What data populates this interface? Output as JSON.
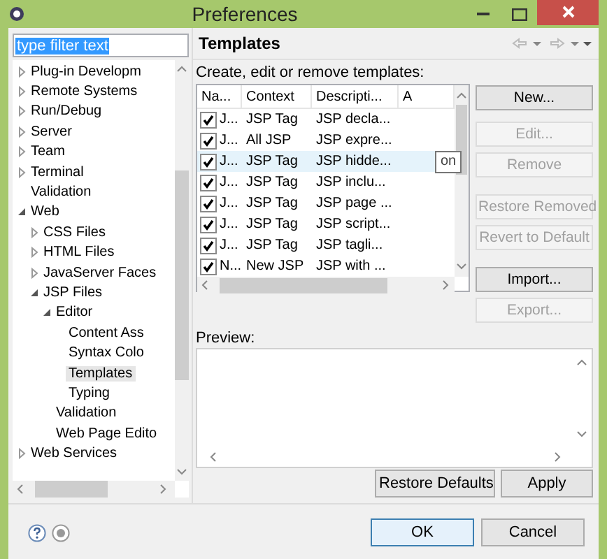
{
  "window": {
    "title": "Preferences"
  },
  "filter": {
    "value": "type filter text"
  },
  "tree": [
    {
      "label": "Plug-in Developm",
      "expanded": false,
      "selected": false
    },
    {
      "label": "Remote Systems",
      "expanded": false,
      "selected": false
    },
    {
      "label": "Run/Debug",
      "expanded": false,
      "selected": false
    },
    {
      "label": "Server",
      "expanded": false,
      "selected": false
    },
    {
      "label": "Team",
      "expanded": false,
      "selected": false
    },
    {
      "label": "Terminal",
      "expanded": false,
      "selected": false
    },
    {
      "label": "Validation",
      "selected": false
    },
    {
      "label": "Web",
      "expanded": true,
      "selected": false,
      "children": [
        {
          "label": "CSS Files",
          "expanded": false,
          "selected": false
        },
        {
          "label": "HTML Files",
          "expanded": false,
          "selected": false
        },
        {
          "label": "JavaServer Faces",
          "expanded": false,
          "selected": false
        },
        {
          "label": "JSP Files",
          "expanded": true,
          "selected": false,
          "children": [
            {
              "label": "Editor",
              "expanded": true,
              "selected": false,
              "children": [
                {
                  "label": "Content Ass",
                  "selected": false
                },
                {
                  "label": "Syntax Colo",
                  "selected": false
                },
                {
                  "label": "Templates",
                  "selected": true
                },
                {
                  "label": "Typing",
                  "selected": false
                }
              ]
            },
            {
              "label": "Validation",
              "selected": false
            },
            {
              "label": "Web Page Edito",
              "selected": false
            }
          ]
        }
      ]
    },
    {
      "label": "Web Services",
      "expanded": false,
      "selected": false
    }
  ],
  "page": {
    "title": "Templates",
    "description": "Create, edit or remove templates:",
    "preview_label": "Preview:"
  },
  "table": {
    "columns": [
      "Na...",
      "Context",
      "Descripti...",
      "A"
    ],
    "rows": [
      {
        "checked": true,
        "name": "J...",
        "context": "JSP Tag",
        "description": "JSP decla...",
        "selected": false
      },
      {
        "checked": true,
        "name": "J...",
        "context": "All JSP",
        "description": "JSP expre...",
        "selected": false
      },
      {
        "checked": true,
        "name": "J...",
        "context": "JSP Tag",
        "description": "JSP hidde...",
        "selected": true
      },
      {
        "checked": true,
        "name": "J...",
        "context": "JSP Tag",
        "description": "JSP inclu...",
        "selected": false
      },
      {
        "checked": true,
        "name": "J...",
        "context": "JSP Tag",
        "description": "JSP page ...",
        "selected": false
      },
      {
        "checked": true,
        "name": "J...",
        "context": "JSP Tag",
        "description": "JSP script...",
        "selected": false
      },
      {
        "checked": true,
        "name": "J...",
        "context": "JSP Tag",
        "description": "JSP tagli...",
        "selected": false
      },
      {
        "checked": true,
        "name": "N...",
        "context": "New JSP",
        "description": "JSP with ...",
        "selected": false
      }
    ],
    "tooltip": "on"
  },
  "side_buttons": [
    {
      "label": "New...",
      "disabled": false
    },
    {
      "label": "Edit...",
      "disabled": true
    },
    {
      "label": "Remove",
      "disabled": true
    },
    {
      "label": "Restore Removed",
      "disabled": true
    },
    {
      "label": "Revert to Default",
      "disabled": true
    },
    {
      "label": "Import...",
      "disabled": false
    },
    {
      "label": "Export...",
      "disabled": true
    }
  ],
  "page_buttons": [
    "Restore Defaults",
    "Apply"
  ],
  "dialog_buttons": [
    {
      "label": "OK",
      "default": true
    },
    {
      "label": "Cancel",
      "default": false
    }
  ]
}
